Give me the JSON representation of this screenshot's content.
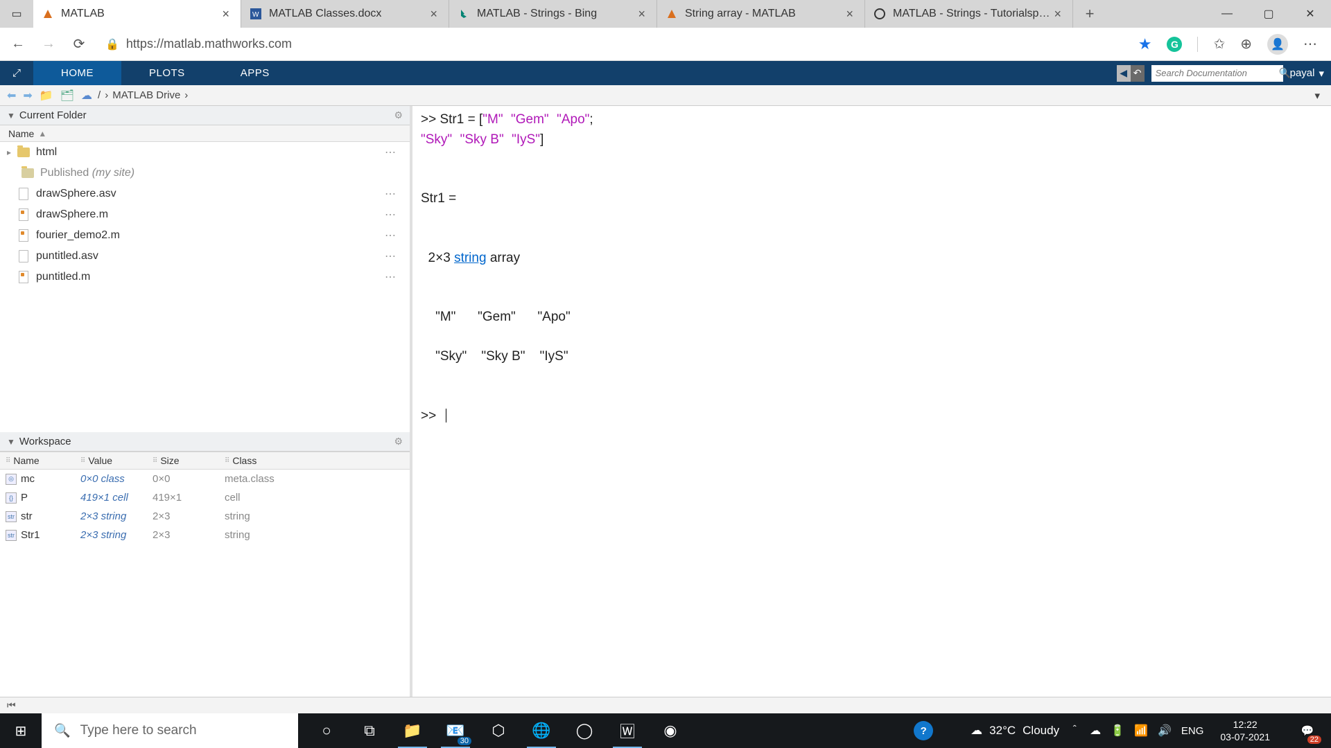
{
  "browser": {
    "tabs": [
      {
        "title": "MATLAB"
      },
      {
        "title": "MATLAB Classes.docx"
      },
      {
        "title": "MATLAB - Strings - Bing"
      },
      {
        "title": "String array - MATLAB"
      },
      {
        "title": "MATLAB - Strings - Tutorialspoin"
      }
    ],
    "url": "https://matlab.mathworks.com"
  },
  "toolstrip": {
    "tabs": {
      "home": "HOME",
      "plots": "PLOTS",
      "apps": "APPS"
    },
    "search_placeholder": "Search Documentation",
    "user": "payal"
  },
  "pathbar": {
    "drive_label": "MATLAB Drive",
    "sep": "›"
  },
  "current_folder": {
    "title": "Current Folder",
    "name_col": "Name",
    "items": [
      {
        "name": "html",
        "kind": "folder",
        "expandable": true
      },
      {
        "name_prefix": "Published ",
        "name_suffix": "(my site)",
        "kind": "folder",
        "child": true
      },
      {
        "name": "drawSphere.asv",
        "kind": "doc"
      },
      {
        "name": "drawSphere.m",
        "kind": "m"
      },
      {
        "name": "fourier_demo2.m",
        "kind": "m"
      },
      {
        "name": "puntitled.asv",
        "kind": "doc"
      },
      {
        "name": "puntitled.m",
        "kind": "m"
      }
    ]
  },
  "workspace": {
    "title": "Workspace",
    "cols": {
      "name": "Name",
      "value": "Value",
      "size": "Size",
      "class": "Class"
    },
    "vars": [
      {
        "name": "mc",
        "value": "0×0 class",
        "size": "0×0",
        "class": "meta.class"
      },
      {
        "name": "P",
        "value": "419×1 cell",
        "size": "419×1",
        "class": "cell"
      },
      {
        "name": "str",
        "value": "2×3 string",
        "size": "2×3",
        "class": "string"
      },
      {
        "name": "Str1",
        "value": "2×3 string",
        "size": "2×3",
        "class": "string"
      }
    ]
  },
  "command": {
    "prompt": ">>",
    "line1_pre": " Str1 = [",
    "s1": "\"M\"",
    "s2": "\"Gem\"",
    "s3": "\"Apo\"",
    "line1_post": ";",
    "s4": "\"Sky\"",
    "s5": "\"Sky B\"",
    "s6": "\"IyS\"",
    "line2_post": "]",
    "result_var": "Str1 =",
    "dim_pre": "  2×3 ",
    "dim_link": "string",
    "dim_post": " array",
    "row1": "    \"M\"      \"Gem\"      \"Apo\"",
    "row2": "    \"Sky\"    \"Sky B\"    \"IyS\""
  },
  "taskbar": {
    "search_placeholder": "Type here to search",
    "weather_temp": "32°C",
    "weather_cond": "Cloudy",
    "lang": "ENG",
    "time": "12:22",
    "date": "03-07-2021",
    "mail_badge": "30",
    "action_badge": "22"
  }
}
